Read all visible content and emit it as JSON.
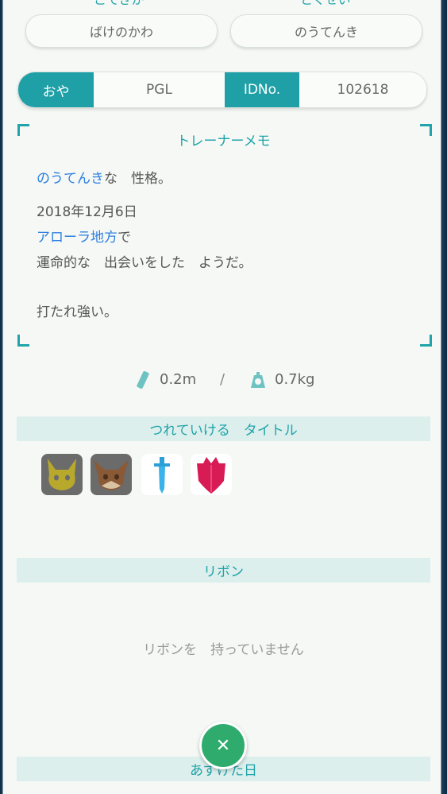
{
  "top": {
    "left_label": "こてきか",
    "right_label": "とくせい",
    "left_value": "ばけのかわ",
    "right_value": "のうてんき"
  },
  "tabs": [
    {
      "label": "おや",
      "active": true
    },
    {
      "label": "PGL",
      "active": false
    },
    {
      "label": "IDNo.",
      "active": true
    },
    {
      "label": "102618",
      "active": false
    }
  ],
  "memo": {
    "title": "トレーナーメモ",
    "nature_highlight": "のうてんき",
    "nature_rest": "な　性格。",
    "date": "2018年12月6日",
    "region_highlight": "アローラ地方",
    "region_rest": "で",
    "encounter": "運命的な　出会いをした　ようだ。",
    "trait": "打たれ強い。"
  },
  "size": {
    "height": "0.2m",
    "separator": "/",
    "weight": "0.7kg",
    "height_icon": "ruler-icon",
    "weight_icon": "scale-icon"
  },
  "sections": {
    "titles": "つれていける　タイトル",
    "ribbons": "リボン",
    "no_ribbons": "リボンを　持っていません",
    "visited": "あずけた日"
  },
  "badges": [
    {
      "icon": "pikachu-badge-icon"
    },
    {
      "icon": "eevee-badge-icon"
    },
    {
      "icon": "sword-badge-icon"
    },
    {
      "icon": "shield-badge-icon"
    }
  ],
  "close": {
    "symbol": "✕"
  },
  "colors": {
    "accent": "#1ea0a6",
    "highlight": "#2c7fe0",
    "section_bg": "#dcefec",
    "close_btn": "#2fac6d"
  }
}
